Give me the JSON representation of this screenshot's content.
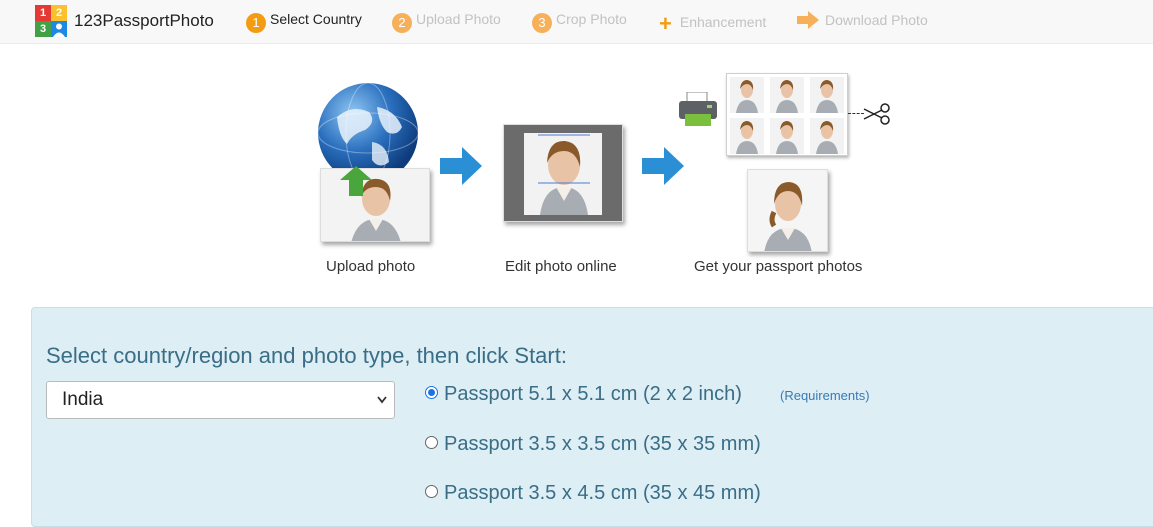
{
  "header": {
    "brand": "123PassportPhoto",
    "logo_digits": [
      "1",
      "2",
      "3"
    ],
    "steps": [
      {
        "num": "1",
        "label": "Select Country",
        "active": true
      },
      {
        "num": "2",
        "label": "Upload Photo",
        "active": false
      },
      {
        "num": "3",
        "label": "Crop Photo",
        "active": false
      },
      {
        "icon": "plus-icon",
        "label": "Enhancement",
        "active": false
      },
      {
        "icon": "arrow-right-icon",
        "label": "Download Photo",
        "active": false
      }
    ]
  },
  "illustration": {
    "captions": [
      "Upload photo",
      "Edit photo online",
      "Get your passport photos"
    ],
    "icons": [
      "globe-icon",
      "upload-arrow-icon",
      "next-arrow-icon",
      "printer-icon",
      "scissors-icon"
    ]
  },
  "selection": {
    "title": "Select country/region and photo type, then click Start:",
    "country": "India",
    "options": [
      {
        "label": "Passport 5.1 x 5.1 cm (2 x 2 inch)",
        "checked": true
      },
      {
        "label": "Passport 3.5 x 3.5 cm (35 x 35 mm)",
        "checked": false
      },
      {
        "label": "Passport 3.5 x 4.5 cm (35 x 45 mm)",
        "checked": false
      }
    ],
    "requirements_link": "(Requirements)"
  },
  "colors": {
    "accent": "#f39c12",
    "panel_bg": "#ddeef5",
    "title_text": "#3a6d86",
    "arrow_blue": "#2b8fd6"
  }
}
